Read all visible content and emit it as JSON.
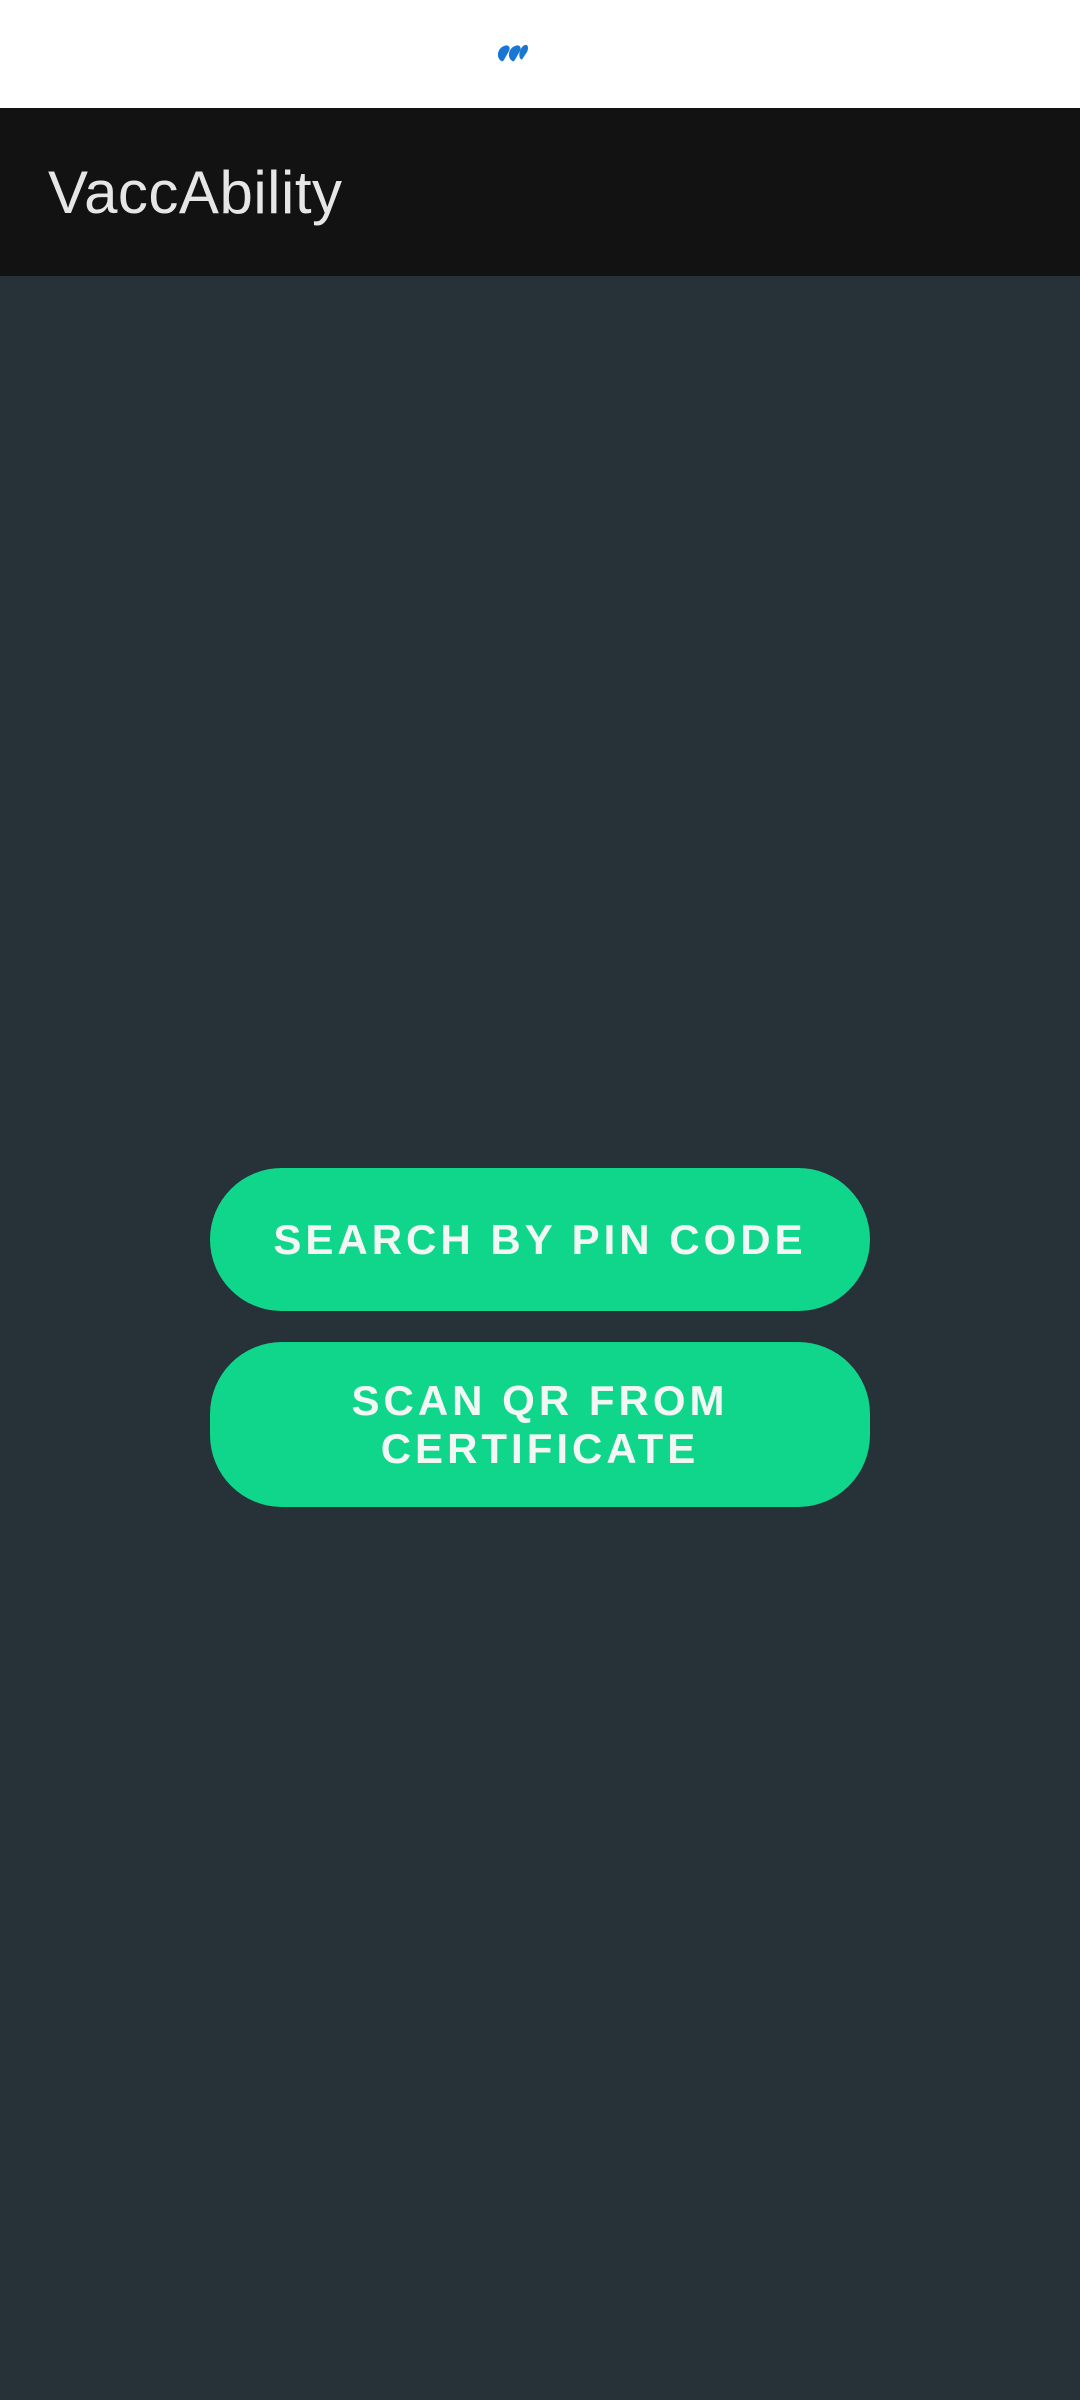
{
  "status_bar": {
    "icon": "app-notification-icon",
    "accent": "#1976d2"
  },
  "app_bar": {
    "title": "VaccAbility"
  },
  "main": {
    "search_pin_label": "SEARCH BY PIN CODE",
    "scan_qr_label": "SCAN QR FROM CERTIFICATE"
  },
  "colors": {
    "accent": "#10d68c",
    "background": "#263238",
    "app_bar": "#121212"
  }
}
